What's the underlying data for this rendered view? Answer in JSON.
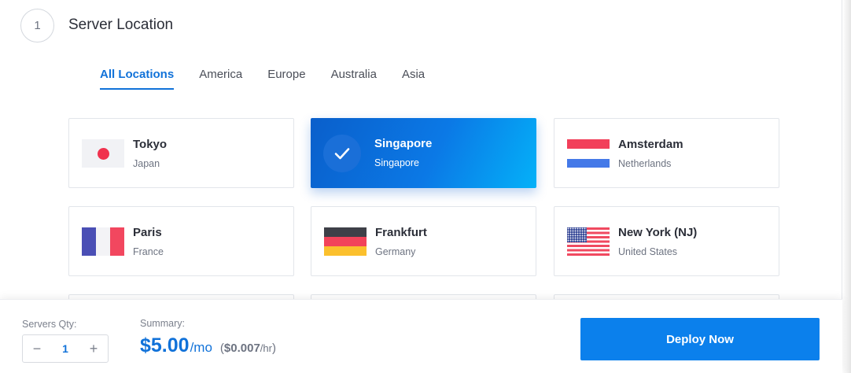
{
  "section": {
    "step_number": "1",
    "title": "Server Location"
  },
  "tabs": [
    {
      "label": "All Locations",
      "active": true
    },
    {
      "label": "America",
      "active": false
    },
    {
      "label": "Europe",
      "active": false
    },
    {
      "label": "Australia",
      "active": false
    },
    {
      "label": "Asia",
      "active": false
    }
  ],
  "locations": [
    {
      "city": "Tokyo",
      "country": "Japan",
      "flag": "japan-flag-icon",
      "selected": false
    },
    {
      "city": "Singapore",
      "country": "Singapore",
      "flag": "check-icon",
      "selected": true
    },
    {
      "city": "Amsterdam",
      "country": "Netherlands",
      "flag": "netherlands-flag-icon",
      "selected": false
    },
    {
      "city": "Paris",
      "country": "France",
      "flag": "france-flag-icon",
      "selected": false
    },
    {
      "city": "Frankfurt",
      "country": "Germany",
      "flag": "germany-flag-icon",
      "selected": false
    },
    {
      "city": "New York (NJ)",
      "country": "United States",
      "flag": "usa-flag-icon",
      "selected": false
    }
  ],
  "footer": {
    "qty_label": "Servers Qty:",
    "qty_value": "1",
    "minus_symbol": "−",
    "plus_symbol": "+",
    "summary_label": "Summary:",
    "price_monthly": "$5.00",
    "price_monthly_unit": "/mo",
    "price_hourly_open": "(",
    "price_hourly": "$0.007",
    "price_hourly_unit": "/hr",
    "price_hourly_close": ")",
    "deploy_label": "Deploy Now"
  },
  "colors": {
    "accent": "#1172d9",
    "deploy_button": "#0b80ec",
    "selected_gradient_start": "#0a5fcb",
    "selected_gradient_end": "#04b1f8",
    "flag_red": "#f0324e",
    "flag_blue": "#4479e8"
  }
}
